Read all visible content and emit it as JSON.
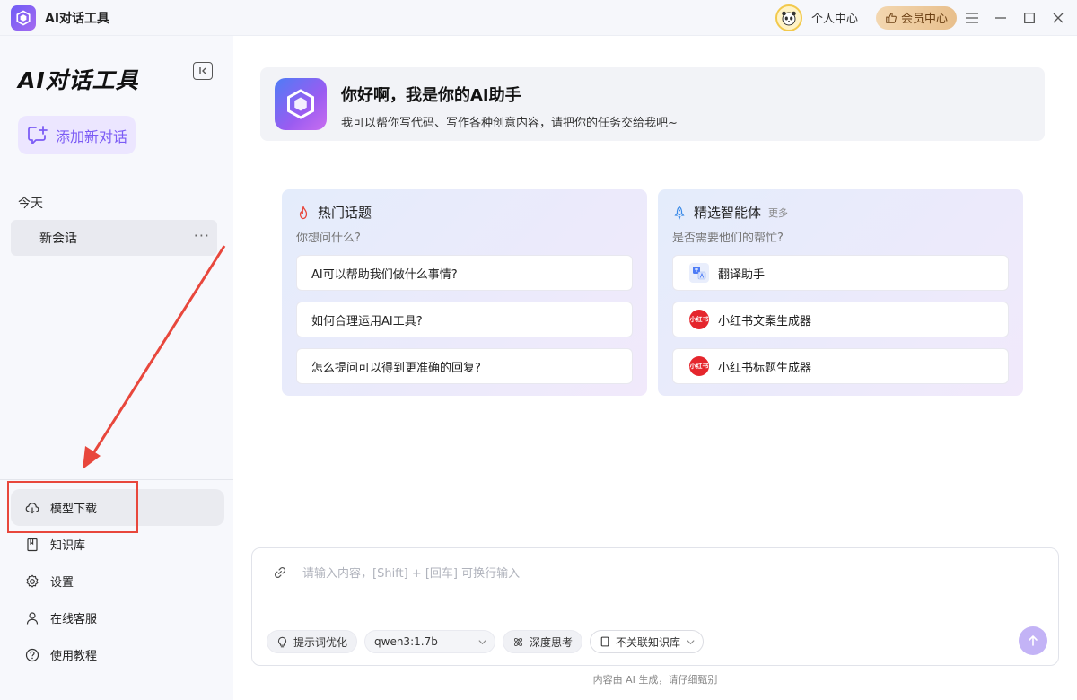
{
  "titlebar": {
    "app_title": "AI对话工具",
    "user_center": "个人中心",
    "vip_label": "会员中心"
  },
  "sidebar": {
    "title": "AI对话工具",
    "new_chat": "添加新对话",
    "group_today": "今天",
    "conversation": "新会话",
    "more": "···",
    "nav": [
      {
        "label": "模型下载",
        "icon": "cloud-download-icon"
      },
      {
        "label": "知识库",
        "icon": "book-icon"
      },
      {
        "label": "设置",
        "icon": "gear-icon"
      },
      {
        "label": "在线客服",
        "icon": "person-icon"
      },
      {
        "label": "使用教程",
        "icon": "help-circle-icon"
      }
    ]
  },
  "welcome": {
    "title": "你好啊，我是你的AI助手",
    "subtitle": "我可以帮你写代码、写作各种创意内容，请把你的任务交给我吧~"
  },
  "hot_topics": {
    "title": "热门话题",
    "subtitle": "你想问什么?",
    "items": [
      "AI可以帮助我们做什么事情?",
      "如何合理运用AI工具?",
      "怎么提问可以得到更准确的回复?"
    ]
  },
  "agents": {
    "title": "精选智能体",
    "more": "更多",
    "subtitle": "是否需要他们的帮忙?",
    "items": [
      {
        "label": "翻译助手",
        "icon": "translate-icon"
      },
      {
        "label": "小红书文案生成器",
        "icon": "xiaohongshu-icon",
        "icon_text": "小红书"
      },
      {
        "label": "小红书标题生成器",
        "icon": "xiaohongshu-icon",
        "icon_text": "小红书"
      }
    ]
  },
  "input": {
    "placeholder": "请输入内容，[Shift] + [回车] 可换行输入",
    "prompt_optimize": "提示词优化",
    "model": "qwen3:1.7b",
    "deep_think": "深度思考",
    "knowledge": "不关联知识库"
  },
  "footer_note": "内容由 AI 生成，请仔细甄别",
  "colors": {
    "accent": "#7c5cf5",
    "annotation": "#e8473c",
    "vip": "#e8bf8c"
  }
}
